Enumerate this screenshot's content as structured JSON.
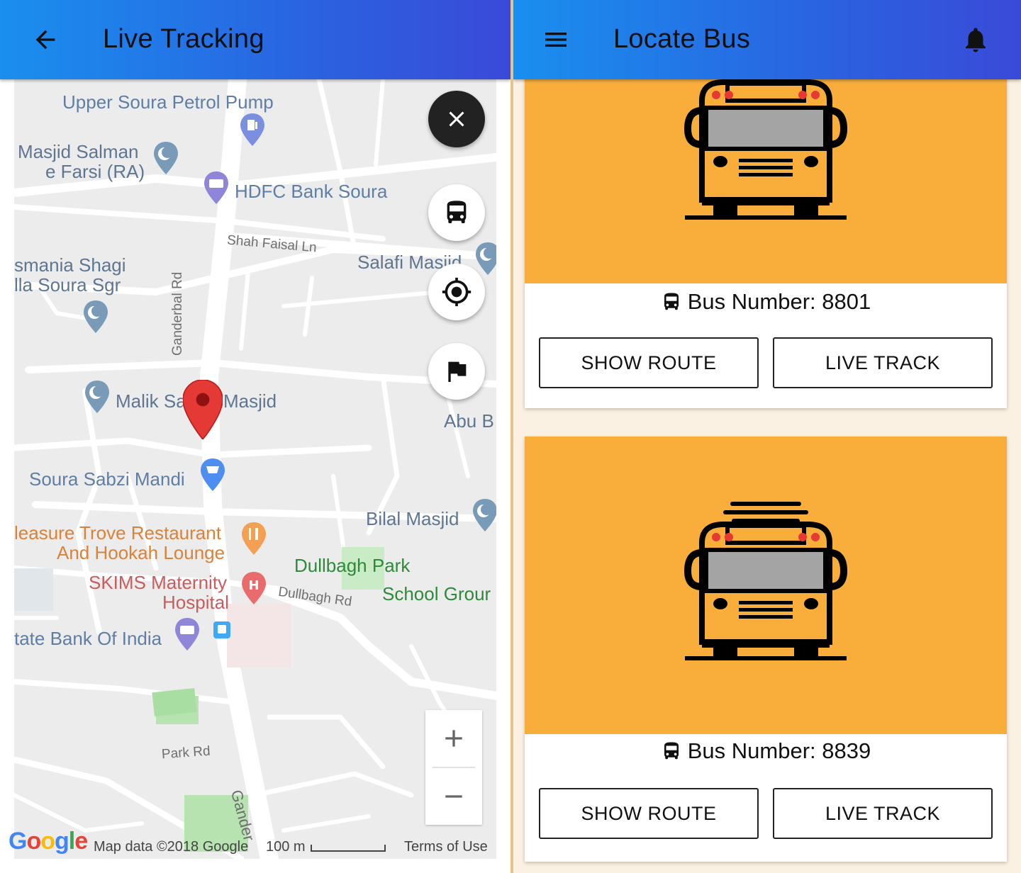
{
  "left": {
    "title": "Live Tracking",
    "map_labels": {
      "petrol_pump": "Upper Soura Petrol Pump",
      "masjid_salman": "Masjid Salman",
      "farsi": "e Farsi (RA)",
      "hdfc": "HDFC Bank Soura",
      "shah_faisal": "Shah Faisal Ln",
      "salafi": "Salafi Masjid",
      "osmania": "smania Shagi",
      "illa_soura": "lla Soura Sgr",
      "ganderbal_rd": "Ganderbal Rd",
      "malik_sahib": "Malik Sa",
      "masjid": "Masjid",
      "abu_b": "Abu B",
      "sabzi_mandi": "Soura Sabzi Mandi",
      "bilal_masjid": "Bilal Masjid",
      "pleasure_trove": "leasure Trove Restaurant",
      "hookah": "And Hookah Lounge",
      "dullbagh_park": "Dullbagh Park",
      "skims": "SKIMS Maternity",
      "hospital": "Hospital",
      "dullbagh_rd": "Dullbagh Rd",
      "school_ground": "School Grour",
      "sbi": "tate Bank Of India",
      "park_rd": "Park Rd",
      "ganderbal_rd_2": "Gander"
    },
    "attribution": {
      "google": "Google",
      "map_data": "Map data ©2018 Google",
      "scale": "100 m",
      "terms": "Terms of Use"
    }
  },
  "right": {
    "title": "Locate Bus",
    "buses": [
      {
        "bus_label": "Bus Number: 8801",
        "show_route": "SHOW ROUTE",
        "live_track": "LIVE TRACK"
      },
      {
        "bus_label": "Bus Number: 8839",
        "show_route": "SHOW ROUTE",
        "live_track": "LIVE TRACK"
      }
    ]
  },
  "colors": {
    "appbar_start": "#1a8fef",
    "appbar_end": "#3a4ad8",
    "card_image_bg": "#f9ae3c",
    "map_marker": "#e53935"
  },
  "icons": [
    "back-arrow-icon",
    "close-icon",
    "bus-icon",
    "my-location-icon",
    "flag-icon",
    "zoom-in-icon",
    "zoom-out-icon",
    "menu-icon",
    "bell-icon",
    "location-pin-icon"
  ]
}
